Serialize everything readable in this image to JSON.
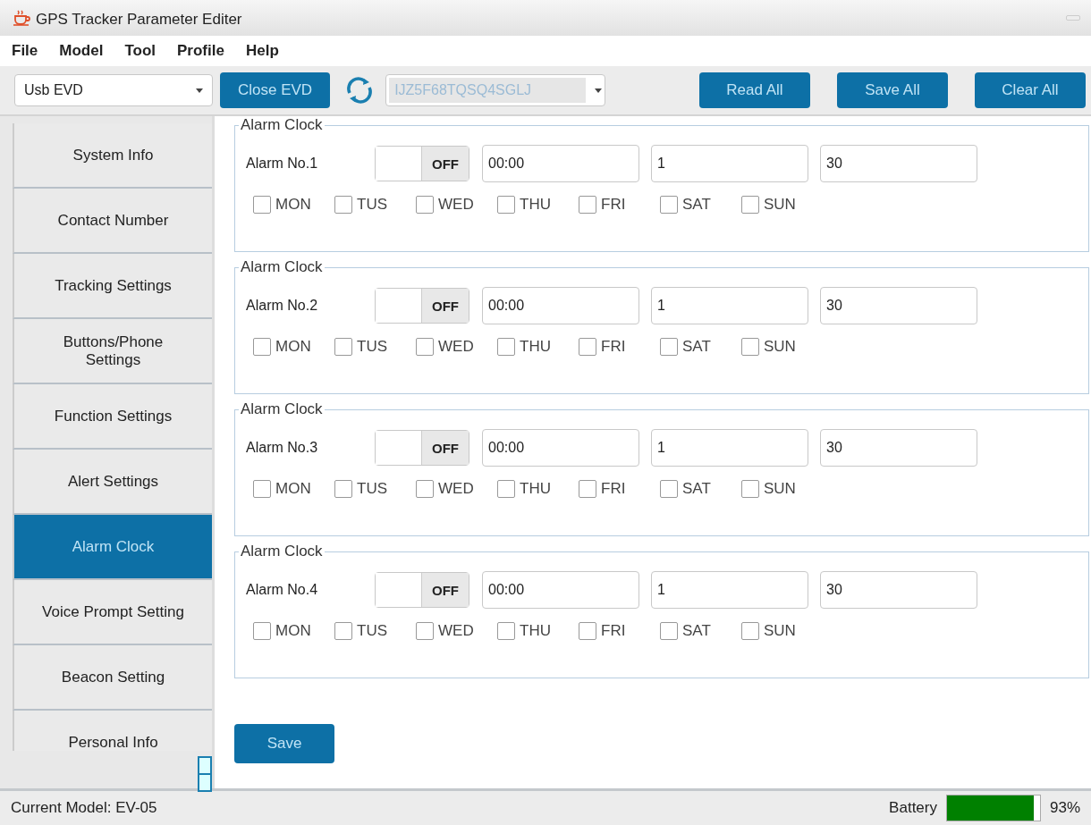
{
  "window": {
    "title": "GPS Tracker Parameter Editer"
  },
  "menu": [
    "File",
    "Model",
    "Tool",
    "Profile",
    "Help"
  ],
  "toolbar": {
    "port": "Usb EVD",
    "connect_button": "Close EVD",
    "device_id": "IJZ5F68TQSQ4SGLJ",
    "buttons": [
      "Read All",
      "Save All",
      "Clear All"
    ]
  },
  "sidebar": {
    "items": [
      {
        "label": "System Info",
        "selected": false
      },
      {
        "label": "Contact Number",
        "selected": false
      },
      {
        "label": "Tracking Settings",
        "selected": false
      },
      {
        "label": "Buttons/Phone Settings",
        "selected": false
      },
      {
        "label": "Function Settings",
        "selected": false
      },
      {
        "label": "Alert Settings",
        "selected": false
      },
      {
        "label": "Alarm Clock",
        "selected": true
      },
      {
        "label": "Voice Prompt Setting",
        "selected": false
      },
      {
        "label": "Beacon Setting",
        "selected": false
      },
      {
        "label": "Personal Info",
        "selected": false
      }
    ]
  },
  "alarms": [
    {
      "group": "Alarm Clock",
      "label": "Alarm No.1",
      "switch": "OFF",
      "on": false,
      "time": "00:00",
      "field_2": "1",
      "field_3": "30",
      "days": [
        {
          "label": "MON",
          "checked": false
        },
        {
          "label": "TUS",
          "checked": false
        },
        {
          "label": "WED",
          "checked": false
        },
        {
          "label": "THU",
          "checked": false
        },
        {
          "label": "FRI",
          "checked": false
        },
        {
          "label": "SAT",
          "checked": false
        },
        {
          "label": "SUN",
          "checked": false
        }
      ]
    },
    {
      "group": "Alarm Clock",
      "label": "Alarm No.2",
      "switch": "OFF",
      "on": false,
      "time": "00:00",
      "field_2": "1",
      "field_3": "30",
      "days": [
        {
          "label": "MON",
          "checked": false
        },
        {
          "label": "TUS",
          "checked": false
        },
        {
          "label": "WED",
          "checked": false
        },
        {
          "label": "THU",
          "checked": false
        },
        {
          "label": "FRI",
          "checked": false
        },
        {
          "label": "SAT",
          "checked": false
        },
        {
          "label": "SUN",
          "checked": false
        }
      ]
    },
    {
      "group": "Alarm Clock",
      "label": "Alarm No.3",
      "switch": "OFF",
      "on": false,
      "time": "00:00",
      "field_2": "1",
      "field_3": "30",
      "days": [
        {
          "label": "MON",
          "checked": false
        },
        {
          "label": "TUS",
          "checked": false
        },
        {
          "label": "WED",
          "checked": false
        },
        {
          "label": "THU",
          "checked": false
        },
        {
          "label": "FRI",
          "checked": false
        },
        {
          "label": "SAT",
          "checked": false
        },
        {
          "label": "SUN",
          "checked": false
        }
      ]
    },
    {
      "group": "Alarm Clock",
      "label": "Alarm No.4",
      "switch": "OFF",
      "on": false,
      "time": "00:00",
      "field_2": "1",
      "field_3": "30",
      "days": [
        {
          "label": "MON",
          "checked": false
        },
        {
          "label": "TUS",
          "checked": false
        },
        {
          "label": "WED",
          "checked": false
        },
        {
          "label": "THU",
          "checked": false
        },
        {
          "label": "FRI",
          "checked": false
        },
        {
          "label": "SAT",
          "checked": false
        },
        {
          "label": "SUN",
          "checked": false
        }
      ]
    }
  ],
  "save_button": "Save",
  "status_bar": {
    "model": "Current Model: EV-05",
    "battery_label": "Battery",
    "level": 0.93,
    "reading": "93%"
  }
}
